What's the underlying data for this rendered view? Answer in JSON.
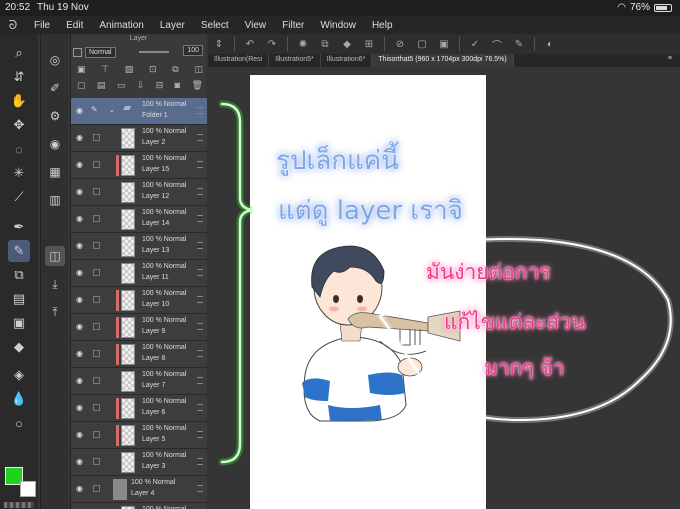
{
  "status": {
    "time": "20:52",
    "date": "Thu 19 Nov",
    "battery": "76%"
  },
  "menu": [
    "File",
    "Edit",
    "Animation",
    "Layer",
    "Select",
    "View",
    "Filter",
    "Window",
    "Help"
  ],
  "layer_panel": {
    "title": "Layer",
    "blend_mode": "Normal",
    "opacity": "100",
    "layers": [
      {
        "opacity": "100 % Normal",
        "name": "Folder 1",
        "kind": "folder",
        "selected": true
      },
      {
        "opacity": "100 % Normal",
        "name": "Layer 2",
        "kind": "layer",
        "clip": false
      },
      {
        "opacity": "100 % Normal",
        "name": "Layer 15",
        "kind": "layer",
        "clip": true
      },
      {
        "opacity": "100 % Normal",
        "name": "Layer 12",
        "kind": "layer",
        "clip": false
      },
      {
        "opacity": "100 % Normal",
        "name": "Layer 14",
        "kind": "layer",
        "clip": false
      },
      {
        "opacity": "100 % Normal",
        "name": "Layer 13",
        "kind": "layer",
        "clip": false
      },
      {
        "opacity": "100 % Normal",
        "name": "Layer 11",
        "kind": "layer",
        "clip": false
      },
      {
        "opacity": "100 % Normal",
        "name": "Layer 10",
        "kind": "layer",
        "clip": true
      },
      {
        "opacity": "100 % Normal",
        "name": "Layer 9",
        "kind": "layer",
        "clip": true
      },
      {
        "opacity": "100 % Normal",
        "name": "Layer 8",
        "kind": "layer",
        "clip": true
      },
      {
        "opacity": "100 % Normal",
        "name": "Layer 7",
        "kind": "layer",
        "clip": false
      },
      {
        "opacity": "100 % Normal",
        "name": "Layer 6",
        "kind": "layer",
        "clip": true
      },
      {
        "opacity": "100 % Normal",
        "name": "Layer 5",
        "kind": "layer",
        "clip": true
      },
      {
        "opacity": "100 % Normal",
        "name": "Layer 3",
        "kind": "layer",
        "clip": false
      },
      {
        "opacity": "100 % Normal",
        "name": "Layer 4",
        "kind": "gray",
        "clip": false
      },
      {
        "opacity": "100 % Normal",
        "name": "",
        "kind": "layer",
        "clip": false
      }
    ]
  },
  "tabs": [
    {
      "label": "Illustration(Resi",
      "active": false
    },
    {
      "label": "Illustration5*",
      "active": false
    },
    {
      "label": "Illustration6*",
      "active": false
    },
    {
      "label": "Thisorthat5 (960 x 1704px 300dpi 76.5%)",
      "active": true
    }
  ],
  "overlay_text": {
    "line1": "รูปเล็กแค่นี้",
    "line2": "แต่ดู layer เราจิ",
    "bubble1": "มันง่ายต่อการ",
    "bubble2": "แก้ไขแต่ละส่วน",
    "bubble3": "มากๆ จ้า"
  },
  "colors": {
    "foreground": "#1ed21e",
    "background": "#ffffff",
    "accent_selected": "#5a6c8e",
    "bracket": "#7dff7d"
  }
}
